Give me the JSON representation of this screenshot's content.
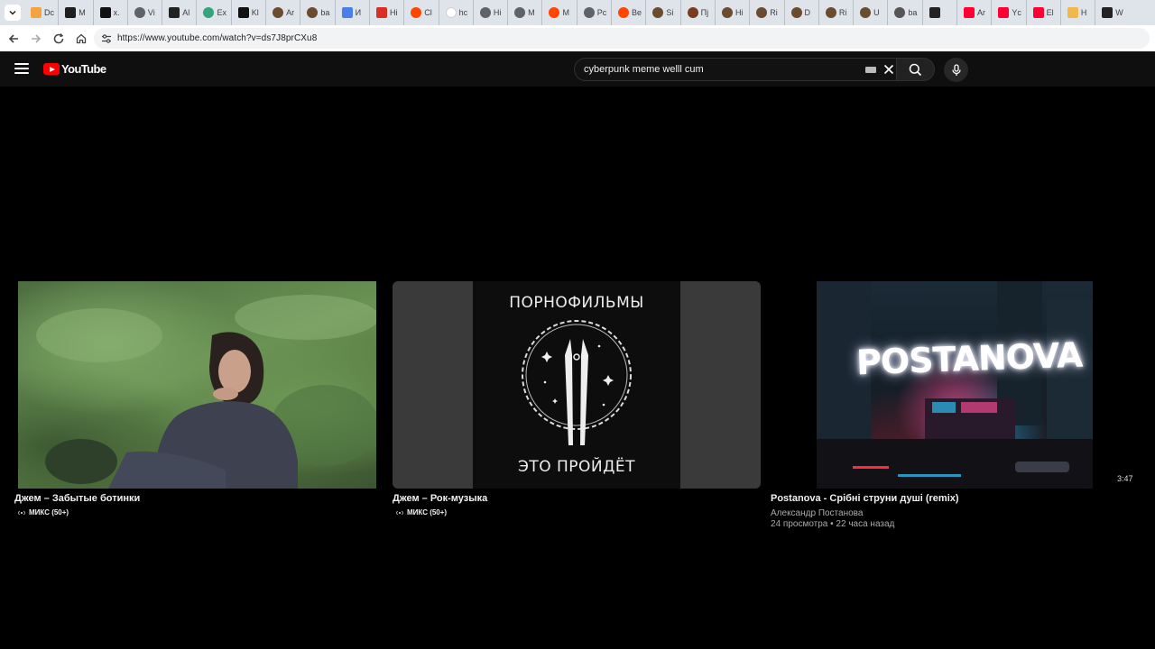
{
  "browser": {
    "tabs": [
      {
        "title": "Dc",
        "icon": "dashboard-favicon",
        "color": "#f4a340"
      },
      {
        "title": "M",
        "icon": "dx-favicon",
        "color": "#1e1e1e"
      },
      {
        "title": "x.",
        "icon": "x-favicon",
        "color": "#111111"
      },
      {
        "title": "Vi",
        "icon": "globe-favicon",
        "color": "#5f6368"
      },
      {
        "title": "Al",
        "icon": "m-favicon",
        "color": "#222222"
      },
      {
        "title": "Ex",
        "icon": "ex-favicon",
        "color": "#33a47c"
      },
      {
        "title": "Kl",
        "icon": "x-favicon",
        "color": "#111111"
      },
      {
        "title": "Ar",
        "icon": "avatar-favicon",
        "color": "#6b4c2e"
      },
      {
        "title": "ba",
        "icon": "avatar-favicon",
        "color": "#6b4c2e"
      },
      {
        "title": "И",
        "icon": "docs-favicon",
        "color": "#4a7ee8"
      },
      {
        "title": "Hi",
        "icon": "bookmark-favicon",
        "color": "#d93025"
      },
      {
        "title": "Cl",
        "icon": "reddit-favicon",
        "color": "#ff4500"
      },
      {
        "title": "hc",
        "icon": "google-favicon",
        "color": "#ffffff"
      },
      {
        "title": "Hi",
        "icon": "globe-favicon",
        "color": "#5f6368"
      },
      {
        "title": "M",
        "icon": "globe-favicon",
        "color": "#5f6368"
      },
      {
        "title": "M",
        "icon": "reddit-favicon",
        "color": "#ff4500"
      },
      {
        "title": "Pc",
        "icon": "globe-favicon",
        "color": "#5f6368"
      },
      {
        "title": "Be",
        "icon": "reddit-favicon",
        "color": "#ff4500"
      },
      {
        "title": "Si",
        "icon": "avatar-favicon",
        "color": "#6b4c2e"
      },
      {
        "title": "Пj",
        "icon": "avatar-favicon",
        "color": "#7a3b1f"
      },
      {
        "title": "Hi",
        "icon": "avatar-favicon",
        "color": "#6b4c2e"
      },
      {
        "title": "Ri",
        "icon": "avatar-favicon",
        "color": "#6b4c2e"
      },
      {
        "title": "D",
        "icon": "avatar-favicon",
        "color": "#6b4c2e"
      },
      {
        "title": "Ri",
        "icon": "avatar-favicon",
        "color": "#6b4c2e"
      },
      {
        "title": "U",
        "icon": "avatar-favicon",
        "color": "#6b4c2e"
      },
      {
        "title": "ba",
        "icon": "avatar-favicon",
        "color": "#555555"
      },
      {
        "title": "",
        "icon": "incognito-favicon",
        "color": "#222222"
      },
      {
        "title": "Ar",
        "icon": "youtube-favicon",
        "color": "#ff0033"
      },
      {
        "title": "Yc",
        "icon": "youtube-favicon",
        "color": "#ff0033"
      },
      {
        "title": "El",
        "icon": "youtube-favicon",
        "color": "#ff0033"
      },
      {
        "title": "H",
        "icon": "w-favicon",
        "color": "#f2b84b"
      },
      {
        "title": "W",
        "icon": "x-favicon",
        "color": "#222222"
      }
    ],
    "url": "https://www.youtube.com/watch?v=ds7J8prCXu8"
  },
  "youtube": {
    "logo_text": "YouTube",
    "search_value": "cyberpunk meme welll cum"
  },
  "videos": [
    {
      "title": "Джем – Забытые ботинки",
      "mix_label": "МИКС (50+)"
    },
    {
      "title": "Джем – Рок-музыка",
      "mix_label": "МИКС (50+)",
      "thumb_top_text": "ПОРНОФИЛЬМЫ",
      "thumb_bottom_text": "ЭТО ПРОЙДЁТ"
    },
    {
      "title": "Postanova - Срібні струни душі (remix)",
      "channel": "Александр Постанова",
      "stats": "24 просмотра • 22 часа назад",
      "duration": "3:47",
      "thumb_text": "POSTANOVA"
    }
  ]
}
